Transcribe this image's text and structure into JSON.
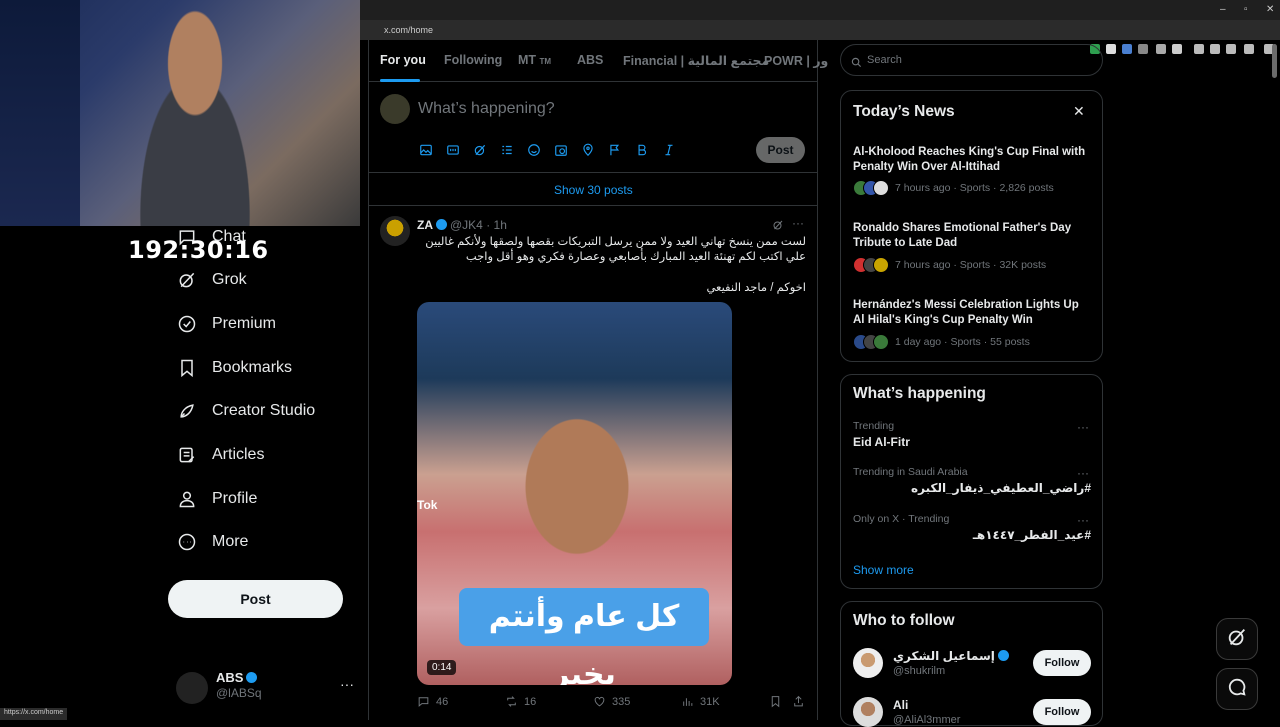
{
  "timer": "192:30:16",
  "browser": {
    "url": "x.com/home",
    "status_url": "https://x.com/home"
  },
  "sidebar": {
    "items": [
      {
        "label": "Chat",
        "icon": "chat-icon"
      },
      {
        "label": "Grok",
        "icon": "grok-icon"
      },
      {
        "label": "Premium",
        "icon": "premium-icon"
      },
      {
        "label": "Bookmarks",
        "icon": "bookmark-icon"
      },
      {
        "label": "Creator Studio",
        "icon": "rocket-icon"
      },
      {
        "label": "Articles",
        "icon": "article-icon"
      },
      {
        "label": "Profile",
        "icon": "profile-icon"
      },
      {
        "label": "More",
        "icon": "more-icon"
      }
    ],
    "post_label": "Post",
    "account": {
      "name": "ABS",
      "handle": "@lABSq",
      "more": "···"
    }
  },
  "tabs": [
    "For you",
    "Following",
    "MT",
    "ABS",
    "Financial | مجتمع المالية",
    "POWR | ور"
  ],
  "tab_mt_suffix": "TM",
  "compose": {
    "placeholder": "What’s happening?",
    "post_label": "Post"
  },
  "show_posts": "Show 30 posts",
  "tweet": {
    "name": "ZA",
    "handle": "@JK4 · 1h",
    "text": "لست ممن ينسخ تهاني العيد ولا ممن يرسل التبريكات بقصها ولصقها ولأنكم غاليين علي اكتب لكم تهنئة العيد المبارك بأصابعي وعصارة فكري وهو أقل واجب",
    "signature": "اخوكم / ماجد النفيعي",
    "video_caption": "كل عام وأنتم بخير",
    "video_duration": "0:14",
    "watermark": "Tok",
    "stats": {
      "replies": "46",
      "reposts": "16",
      "likes": "335",
      "views": "31K"
    }
  },
  "search": {
    "placeholder": "Search"
  },
  "news": {
    "title": "Today’s News",
    "items": [
      {
        "headline": "Al-Kholood Reaches King's Cup Final with Penalty Win Over Al-Ittihad",
        "meta": "7 hours ago · Sports · 2,826 posts"
      },
      {
        "headline": "Ronaldo Shares Emotional Father's Day Tribute to Late Dad",
        "meta": "7 hours ago · Sports · 32K posts"
      },
      {
        "headline": "Hernández's Messi Celebration Lights Up Al Hilal's King's Cup Penalty Win",
        "meta": "1 day ago · Sports · 55 posts"
      }
    ]
  },
  "trends": {
    "title": "What’s happening",
    "items": [
      {
        "meta": "Trending",
        "topic": "Eid Al-Fitr"
      },
      {
        "meta": "Trending in Saudi Arabia",
        "topic": "#راضي_العطيفي_ذيفار_الكبره"
      },
      {
        "meta": "Only on X · Trending",
        "topic": "#عيد_الفطر_١٤٤٧هـ"
      }
    ],
    "show_more": "Show more"
  },
  "who_to_follow": {
    "title": "Who to follow",
    "users": [
      {
        "name": "إسماعيل الشكري",
        "handle": "@shukrilm",
        "button": "Follow"
      },
      {
        "name": "Ali",
        "handle": "@AliAl3mmer",
        "button": "Follow"
      }
    ]
  },
  "colors": {
    "accent": "#1d9bf0",
    "background": "#000000",
    "border": "#2f3336",
    "muted": "#71767b"
  }
}
